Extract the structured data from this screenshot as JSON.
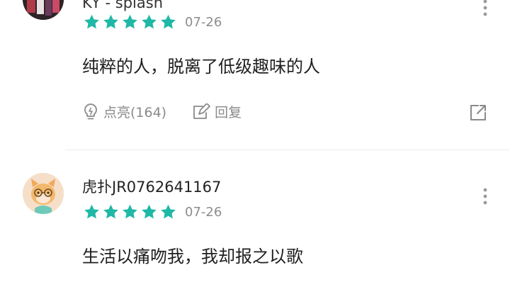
{
  "comments": [
    {
      "username": "KY - splash",
      "rating": 5,
      "date": "07-26",
      "content": "纯粹的人，脱离了低级趣味的人",
      "like_label": "点亮(164)",
      "reply_label": "回复"
    },
    {
      "username": "虎扑JR0762641167",
      "rating": 5,
      "date": "07-26",
      "content": "生活以痛吻我，我却报之以歌"
    }
  ],
  "colors": {
    "star": "#1fb8a6",
    "meta_text": "#8c8c8c",
    "divider": "#ececec"
  },
  "icons": [
    "more-vertical-icon",
    "lightbulb-icon",
    "edit-reply-icon",
    "share-external-icon",
    "star-icon"
  ]
}
